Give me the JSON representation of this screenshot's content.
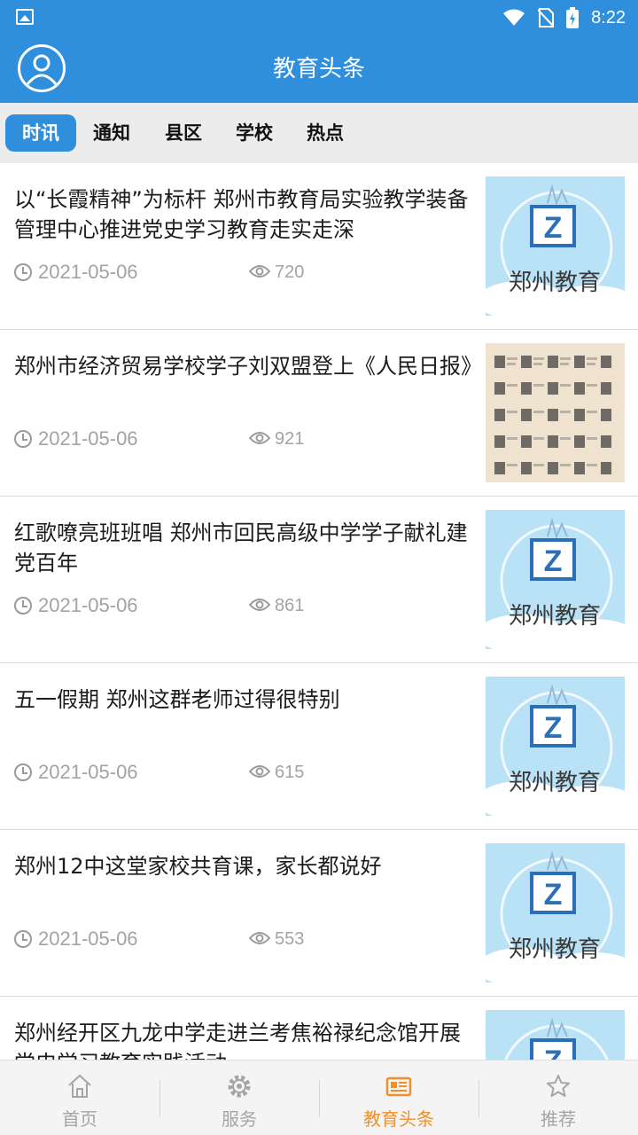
{
  "status_bar": {
    "time": "8:22",
    "icons": [
      "gallery-icon",
      "wifi-icon",
      "no-sim-icon",
      "battery-charging-icon"
    ]
  },
  "header": {
    "title": "教育头条",
    "avatar_icon": "user-avatar-icon"
  },
  "tabs": [
    {
      "label": "时讯",
      "active": true
    },
    {
      "label": "通知",
      "active": false
    },
    {
      "label": "县区",
      "active": false
    },
    {
      "label": "学校",
      "active": false
    },
    {
      "label": "热点",
      "active": false
    }
  ],
  "articles": [
    {
      "title": "以“长霞精神”为标杆 郑州市教育局实验教学装备管理中心推进党史学习教育走实走深",
      "date": "2021-05-06",
      "views": "720",
      "thumb": "郑州教育"
    },
    {
      "title": "郑州市经济贸易学校学子刘双盟登上《人民日报》",
      "date": "2021-05-06",
      "views": "921",
      "thumb": "newspaper"
    },
    {
      "title": "红歌嘹亮班班唱 郑州市回民高级中学学子献礼建党百年",
      "date": "2021-05-06",
      "views": "861",
      "thumb": "郑州教育"
    },
    {
      "title": "五一假期 郑州这群老师过得很特别",
      "date": "2021-05-06",
      "views": "615",
      "thumb": "郑州教育"
    },
    {
      "title": "郑州12中这堂家校共育课，家长都说好",
      "date": "2021-05-06",
      "views": "553",
      "thumb": "郑州教育"
    },
    {
      "title": "郑州经开区九龙中学走进兰考焦裕禄纪念馆开展党史学习教育实践活动",
      "date": "",
      "views": "",
      "thumb": "郑州教育"
    }
  ],
  "bottom_nav": [
    {
      "label": "首页",
      "icon": "home-icon",
      "active": false
    },
    {
      "label": "服务",
      "icon": "gear-icon",
      "active": false
    },
    {
      "label": "教育头条",
      "icon": "newspaper-icon",
      "active": true
    },
    {
      "label": "推荐",
      "icon": "star-icon",
      "active": false
    }
  ],
  "colors": {
    "primary": "#2f8fdc",
    "active_nav": "#f0902a",
    "meta_text": "#a3a3a3"
  }
}
